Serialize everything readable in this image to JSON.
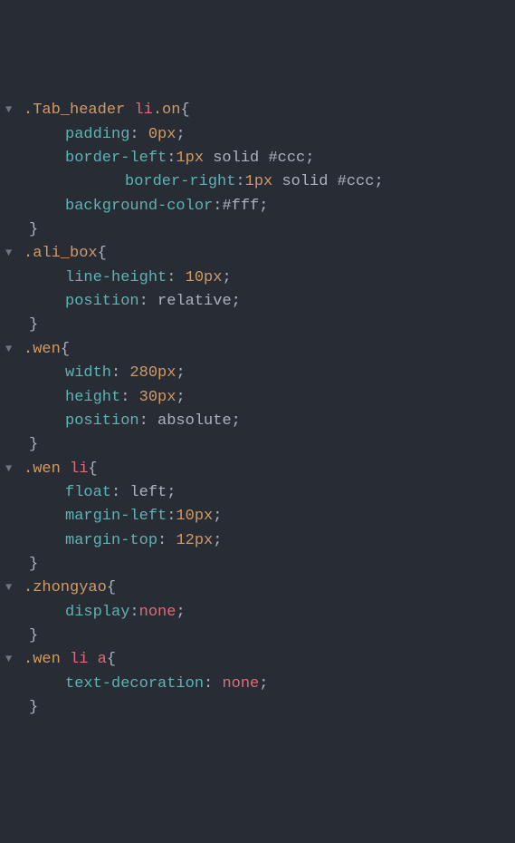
{
  "rules": [
    {
      "selector_parts": [
        ".Tab_header",
        " ",
        "li",
        ".on"
      ],
      "decls": [
        {
          "prop": "padding",
          "value_parts": [
            {
              "t": "num",
              "v": "0px"
            }
          ],
          "indent": 1
        },
        {
          "prop": "border-left",
          "value_parts": [
            {
              "t": "num",
              "v": "1px"
            },
            {
              "t": "sp",
              "v": " "
            },
            {
              "t": "ident",
              "v": "solid"
            },
            {
              "t": "sp",
              "v": " "
            },
            {
              "t": "ident",
              "v": "#ccc"
            }
          ],
          "indent": 1,
          "nospace": true
        },
        {
          "prop": "border-right",
          "value_parts": [
            {
              "t": "num",
              "v": "1px"
            },
            {
              "t": "sp",
              "v": " "
            },
            {
              "t": "ident",
              "v": "solid"
            },
            {
              "t": "sp",
              "v": " "
            },
            {
              "t": "ident",
              "v": "#ccc"
            }
          ],
          "indent": 2,
          "nospace": true
        },
        {
          "prop": "background-color",
          "value_parts": [
            {
              "t": "ident",
              "v": "#fff"
            }
          ],
          "indent": 1,
          "nospace": true
        }
      ]
    },
    {
      "selector_parts": [
        ".ali_box"
      ],
      "decls": [
        {
          "prop": "line-height",
          "value_parts": [
            {
              "t": "num",
              "v": "10px"
            }
          ],
          "indent": 1
        },
        {
          "prop": "position",
          "value_parts": [
            {
              "t": "ident",
              "v": "relative"
            }
          ],
          "indent": 1
        }
      ]
    },
    {
      "selector_parts": [
        ".wen"
      ],
      "decls": [
        {
          "prop": "width",
          "value_parts": [
            {
              "t": "num",
              "v": "280px"
            }
          ],
          "indent": 1
        },
        {
          "prop": "height",
          "value_parts": [
            {
              "t": "num",
              "v": "30px"
            }
          ],
          "indent": 1
        },
        {
          "prop": "position",
          "value_parts": [
            {
              "t": "ident",
              "v": "absolute"
            }
          ],
          "indent": 1
        }
      ]
    },
    {
      "selector_parts": [
        ".wen",
        " ",
        "li"
      ],
      "decls": [
        {
          "prop": "float",
          "value_parts": [
            {
              "t": "ident",
              "v": "left"
            }
          ],
          "indent": 1
        },
        {
          "prop": "margin-left",
          "value_parts": [
            {
              "t": "num",
              "v": "10px"
            }
          ],
          "indent": 1,
          "nospace": true
        },
        {
          "prop": "margin-top",
          "value_parts": [
            {
              "t": "num",
              "v": "12px"
            }
          ],
          "indent": 1
        }
      ]
    },
    {
      "selector_parts": [
        ".zhongyao"
      ],
      "decls": [
        {
          "prop": "display",
          "value_parts": [
            {
              "t": "none",
              "v": "none"
            }
          ],
          "indent": 1,
          "nospace": true
        }
      ]
    },
    {
      "selector_parts": [
        ".wen",
        " ",
        "li",
        " ",
        "a"
      ],
      "decls": [
        {
          "prop": "text-decoration",
          "value_parts": [
            {
              "t": "none",
              "v": "none"
            }
          ],
          "indent": 1
        }
      ]
    }
  ]
}
